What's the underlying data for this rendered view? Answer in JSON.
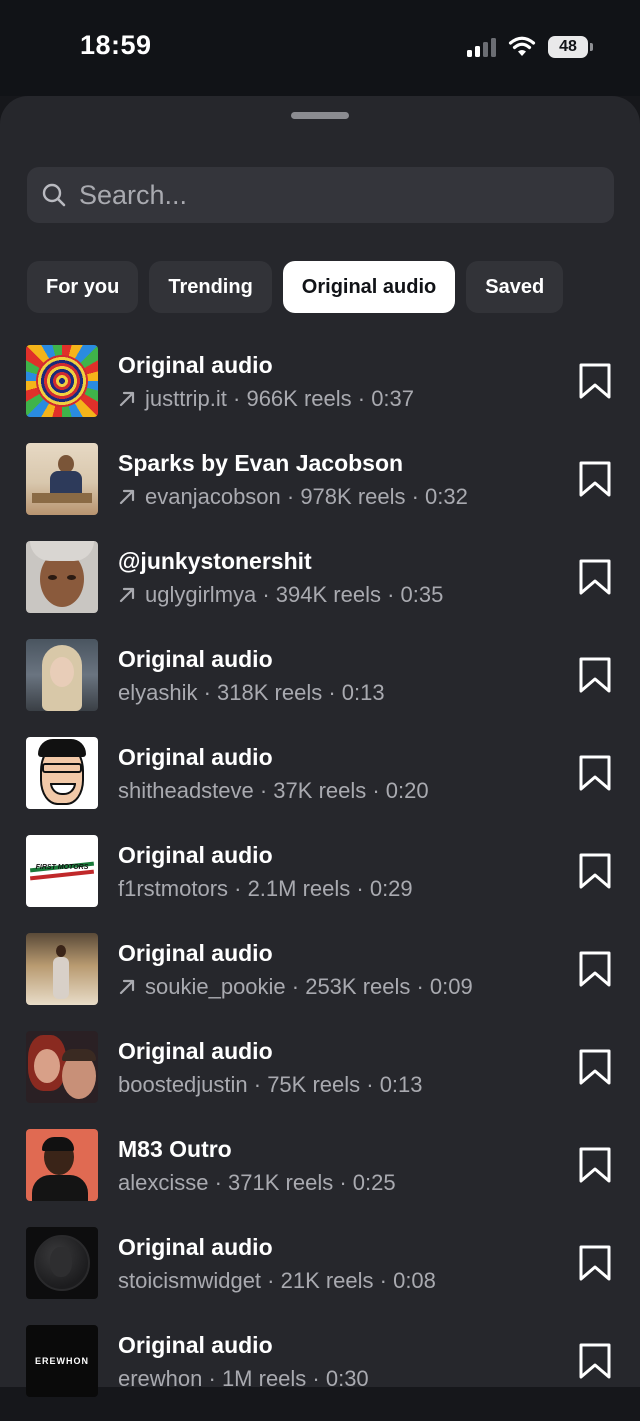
{
  "status": {
    "time": "18:59",
    "battery": "48"
  },
  "search": {
    "placeholder": "Search..."
  },
  "tabs": [
    {
      "label": "For you",
      "active": false
    },
    {
      "label": "Trending",
      "active": false
    },
    {
      "label": "Original audio",
      "active": true
    },
    {
      "label": "Saved",
      "active": false
    }
  ],
  "tracks": [
    {
      "title": "Original audio",
      "meta": "justtrip.it · 966K reels · 0:37",
      "trending": true
    },
    {
      "title": "Sparks by Evan Jacobson",
      "meta": "evanjacobson · 978K reels · 0:32",
      "trending": true
    },
    {
      "title": "@junkystonershit",
      "meta": "uglygirlmya · 394K reels · 0:35",
      "trending": true
    },
    {
      "title": "Original audio",
      "meta": "elyashik · 318K reels · 0:13",
      "trending": false
    },
    {
      "title": "Original audio",
      "meta": "shitheadsteve · 37K reels · 0:20",
      "trending": false
    },
    {
      "title": "Original audio",
      "meta": "f1rstmotors · 2.1M reels · 0:29",
      "trending": false
    },
    {
      "title": "Original audio",
      "meta": "soukie_pookie · 253K reels · 0:09",
      "trending": true
    },
    {
      "title": "Original audio",
      "meta": "boostedjustin · 75K reels · 0:13",
      "trending": false
    },
    {
      "title": "M83 Outro",
      "meta": "alexcisse · 371K reels · 0:25",
      "trending": false
    },
    {
      "title": "Original audio",
      "meta": "stoicismwidget · 21K reels · 0:08",
      "trending": false
    },
    {
      "title": "Original audio",
      "meta": "erewhon · 1M reels · 0:30",
      "trending": false
    }
  ],
  "thumb_text": {
    "first_motors": "FIRST MOTORS",
    "erewhon": "EREWHON"
  },
  "colors": {
    "sheet": "#26272c",
    "active_tab": "#ffffff",
    "secondary_text": "#a9aab0"
  }
}
